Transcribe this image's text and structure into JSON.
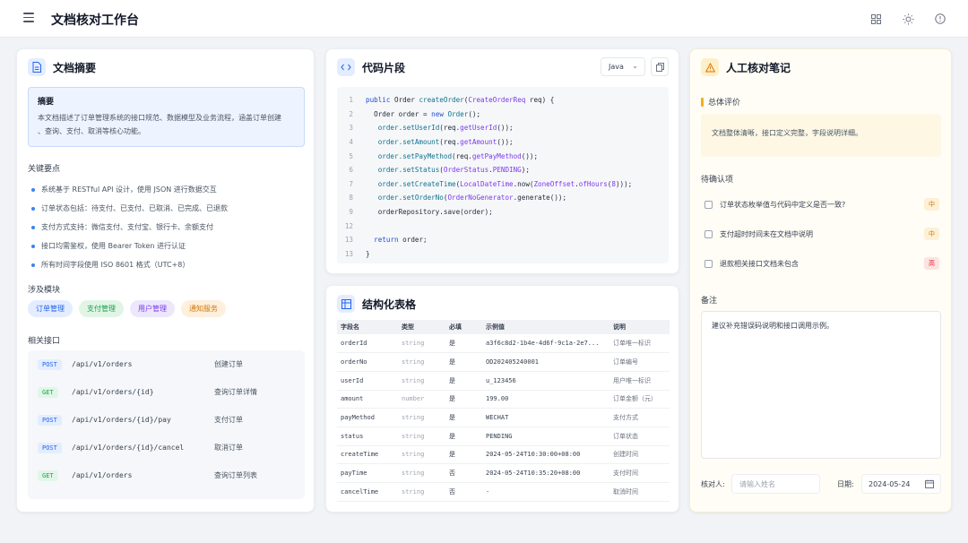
{
  "app": {
    "title": "文档核对工作台"
  },
  "summary": {
    "title": "文档摘要",
    "abstract_title": "摘要",
    "abstract_text_1": "本文档描述了订单管理系统的接口规范、数据模型及业务流程，涵盖订单创建",
    "abstract_text_2": "、查询、支付、取消等核心功能。",
    "key_points_label": "关键要点",
    "key_points": [
      "系统基于 RESTful API 设计，使用 JSON 进行数据交互",
      "订单状态包括：待支付、已支付、已取消、已完成、已退款",
      "支付方式支持：微信支付、支付宝、银行卡、余额支付",
      "接口均需鉴权，使用 Bearer Token 进行认证",
      "所有时间字段使用 ISO 8601 格式（UTC+8）"
    ],
    "modules_label": "涉及模块",
    "modules": [
      {
        "label": "订单管理",
        "bg": "#e4edff",
        "color": "#2563eb"
      },
      {
        "label": "支付管理",
        "bg": "#e1f5e6",
        "color": "#16a34a"
      },
      {
        "label": "用户管理",
        "bg": "#ece7fd",
        "color": "#7c3aed"
      },
      {
        "label": "通知服务",
        "bg": "#fdf0dc",
        "color": "#d97706"
      }
    ],
    "apis_label": "相关接口",
    "apis": [
      {
        "method": "POST",
        "path": "/api/v1/orders",
        "desc": "创建订单"
      },
      {
        "method": "GET",
        "path": "/api/v1/orders/{id}",
        "desc": "查询订单详情"
      },
      {
        "method": "POST",
        "path": "/api/v1/orders/{id}/pay",
        "desc": "支付订单"
      },
      {
        "method": "POST",
        "path": "/api/v1/orders/{id}/cancel",
        "desc": "取消订单"
      },
      {
        "method": "GET",
        "path": "/api/v1/orders",
        "desc": "查询订单列表"
      }
    ]
  },
  "code": {
    "title": "代码片段",
    "language": "Java",
    "lines": [
      {
        "n": "1",
        "segs": [
          [
            "kw",
            "public "
          ],
          [
            "tx",
            "Order "
          ],
          [
            "mt",
            "createOrder"
          ],
          [
            "tx",
            "("
          ],
          [
            "ty",
            "CreateOrderReq"
          ],
          [
            "tx",
            " req) {"
          ]
        ]
      },
      {
        "n": "2",
        "segs": [
          [
            "tx",
            "  "
          ],
          [
            "tx",
            "Order order = "
          ],
          [
            "kw",
            "new "
          ],
          [
            "mt",
            "Order"
          ],
          [
            "tx",
            "();"
          ]
        ]
      },
      {
        "n": "3",
        "segs": [
          [
            "tx",
            "   "
          ],
          [
            "mt",
            "order.setUserId"
          ],
          [
            "tx",
            "(req."
          ],
          [
            "ty",
            "getUserId"
          ],
          [
            "tx",
            "());"
          ]
        ]
      },
      {
        "n": "4",
        "segs": [
          [
            "tx",
            "   "
          ],
          [
            "mt",
            "order.setAmount"
          ],
          [
            "tx",
            "(req."
          ],
          [
            "ty",
            "getAmount"
          ],
          [
            "tx",
            "());"
          ]
        ]
      },
      {
        "n": "5",
        "segs": [
          [
            "tx",
            "   "
          ],
          [
            "mt",
            "order.setPayMethod"
          ],
          [
            "tx",
            "(req."
          ],
          [
            "ty",
            "getPayMethod"
          ],
          [
            "tx",
            "());"
          ]
        ]
      },
      {
        "n": "6",
        "segs": [
          [
            "tx",
            "   "
          ],
          [
            "mt",
            "order.setStatus"
          ],
          [
            "tx",
            "("
          ],
          [
            "ty",
            "OrderStatus"
          ],
          [
            "tx",
            "."
          ],
          [
            "ty",
            "PENDING"
          ],
          [
            "tx",
            ");"
          ]
        ]
      },
      {
        "n": "7",
        "segs": [
          [
            "tx",
            "   "
          ],
          [
            "mt",
            "order.setCreateTime"
          ],
          [
            "tx",
            "("
          ],
          [
            "ty",
            "LocalDateTime"
          ],
          [
            "tx",
            ".now("
          ],
          [
            "ty",
            "ZoneOffset"
          ],
          [
            "tx",
            "."
          ],
          [
            "ty",
            "ofHours"
          ],
          [
            "tx",
            "("
          ],
          [
            "ty",
            "8"
          ],
          [
            "tx",
            ")));"
          ]
        ]
      },
      {
        "n": "8",
        "segs": [
          [
            "tx",
            "   "
          ],
          [
            "mt",
            "order.setOrderNo"
          ],
          [
            "tx",
            "("
          ],
          [
            "ty",
            "OrderNoGenerator"
          ],
          [
            "tx",
            ".generate());"
          ]
        ]
      },
      {
        "n": "9",
        "segs": [
          [
            "tx",
            "   "
          ],
          [
            "tx",
            "orderRepository.save(order);"
          ]
        ]
      },
      {
        "n": "12",
        "segs": [
          [
            "tx",
            ""
          ]
        ]
      },
      {
        "n": "13",
        "segs": [
          [
            "tx",
            "  "
          ],
          [
            "kw",
            "return "
          ],
          [
            "tx",
            "order;"
          ]
        ]
      },
      {
        "n": "13",
        "segs": [
          [
            "tx",
            "}"
          ]
        ]
      }
    ]
  },
  "table": {
    "title": "结构化表格",
    "headers": [
      "字段名",
      "类型",
      "必填",
      "示例值",
      "说明"
    ],
    "rows": [
      [
        "orderId",
        "string",
        "是",
        "a3f6c8d2-1b4e-4d6f-9c1a-2e7...",
        "订单唯一标识"
      ],
      [
        "orderNo",
        "string",
        "是",
        "OD202405240001",
        "订单编号"
      ],
      [
        "userId",
        "string",
        "是",
        "u_123456",
        "用户唯一标识"
      ],
      [
        "amount",
        "number",
        "是",
        "199.00",
        "订单金额（元）"
      ],
      [
        "payMethod",
        "string",
        "是",
        "WECHAT",
        "支付方式"
      ],
      [
        "status",
        "string",
        "是",
        "PENDING",
        "订单状态"
      ],
      [
        "createTime",
        "string",
        "是",
        "2024-05-24T10:30:00+08:00",
        "创建时间"
      ],
      [
        "payTime",
        "string",
        "否",
        "2024-05-24T10:35:20+08:00",
        "支付时间"
      ],
      [
        "cancelTime",
        "string",
        "否",
        "-",
        "取消时间"
      ]
    ]
  },
  "notes": {
    "title": "人工核对笔记",
    "eval_label": "总体评价",
    "eval_text": "文档整体清晰，接口定义完整，字段说明详细。",
    "confirm_label": "待确认项",
    "confirm_items": [
      {
        "text": "订单状态枚举值与代码中定义是否一致?",
        "priority": "中"
      },
      {
        "text": "支付超时时间未在文档中说明",
        "priority": "中"
      },
      {
        "text": "退款相关接口文档未包含",
        "priority": "高"
      }
    ],
    "remark_label": "备注",
    "remark_text": "建议补充错误码说明和接口调用示例。",
    "reviewer_label": "核对人:",
    "reviewer_placeholder": "请输入姓名",
    "date_label": "日期:",
    "date_value": "2024-05-24"
  }
}
